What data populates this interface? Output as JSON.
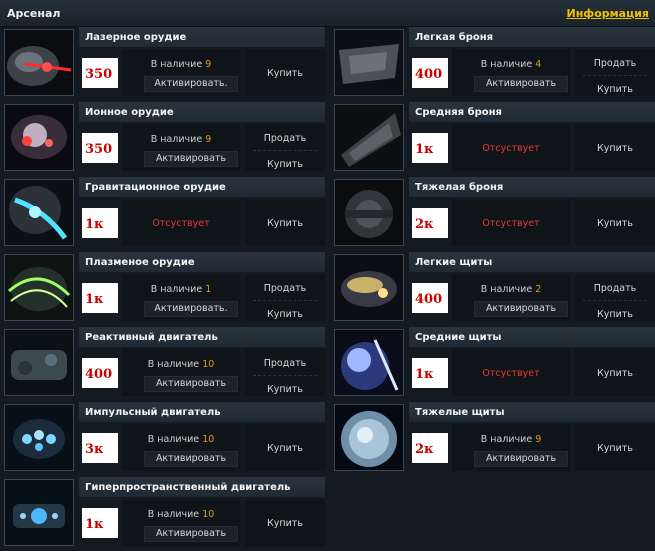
{
  "header": {
    "title": "Арсенал",
    "info_link": "Информация"
  },
  "labels": {
    "in_stock": "В наличие",
    "activate": "Активировать",
    "activate_alt": "Активировать.",
    "buy": "Купить",
    "sell": "Продать",
    "absent": "Отсуствует"
  },
  "colors": {
    "accent": "#f2c200",
    "stock_number": "#e39b1a",
    "absent_text": "#e63a32",
    "price_text": "#c80000"
  },
  "left_items": [
    {
      "name": "Лазерное орудие",
      "price": "350",
      "stock": "9"
    },
    {
      "name": "Ионное орудие",
      "price": "350",
      "stock": "9"
    },
    {
      "name": "Гравитационное орудие",
      "price": "1к",
      "stock": null
    },
    {
      "name": "Плазменое орудие",
      "price": "1к",
      "stock": "1"
    },
    {
      "name": "Реактивный двигатель",
      "price": "400",
      "stock": "10"
    },
    {
      "name": "Импульсный двигатель",
      "price": "3к",
      "stock": "10"
    },
    {
      "name": "Гиперпространственный двигатель",
      "price": "1к",
      "stock": "10"
    }
  ],
  "right_items": [
    {
      "name": "Легкая броня",
      "price": "400",
      "stock": "4"
    },
    {
      "name": "Средняя броня",
      "price": "1к",
      "stock": null
    },
    {
      "name": "Тяжелая броня",
      "price": "2к",
      "stock": null
    },
    {
      "name": "Легкие щиты",
      "price": "400",
      "stock": "2"
    },
    {
      "name": "Средние щиты",
      "price": "1к",
      "stock": null
    },
    {
      "name": "Тяжелые щиты",
      "price": "2к",
      "stock": "9"
    }
  ]
}
